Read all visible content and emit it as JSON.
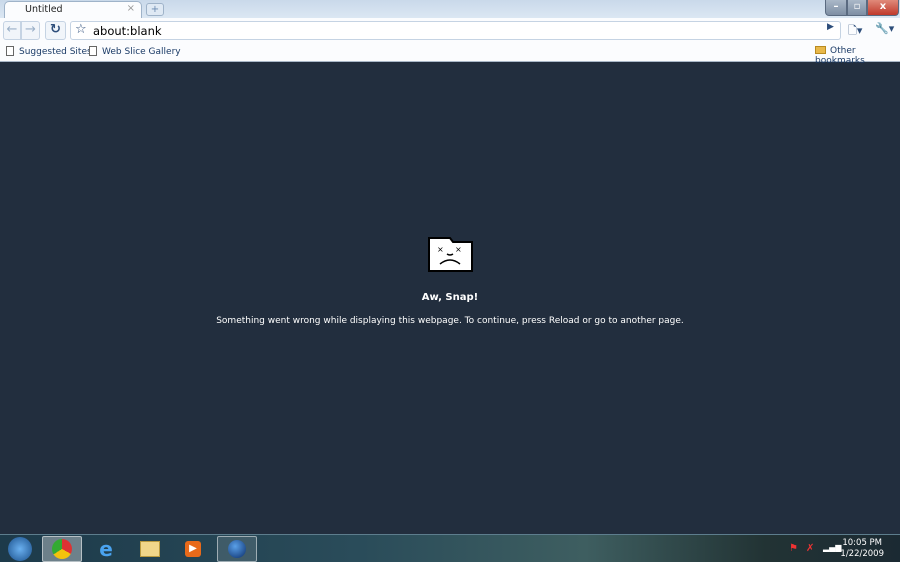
{
  "browser": {
    "tab_title": "Untitled",
    "tab_close": "×",
    "new_tab": "+",
    "address": "about:blank",
    "window_controls": {
      "minimize": "–",
      "maximize": "▫",
      "close": "x"
    }
  },
  "bookmarks": {
    "items": [
      {
        "label": "Suggested Sites"
      },
      {
        "label": "Web Slice Gallery"
      }
    ],
    "other": "Other bookmarks"
  },
  "error": {
    "title": "Aw, Snap!",
    "message": "Something went wrong while displaying this webpage. To continue, press Reload or go to another page."
  },
  "taskbar": {
    "apps": [
      "start",
      "chrome",
      "internet-explorer",
      "windows-explorer",
      "media-player",
      "globe-app"
    ],
    "active": "chrome"
  },
  "tray": {
    "time": "10:05 PM",
    "date": "1/22/2009"
  }
}
